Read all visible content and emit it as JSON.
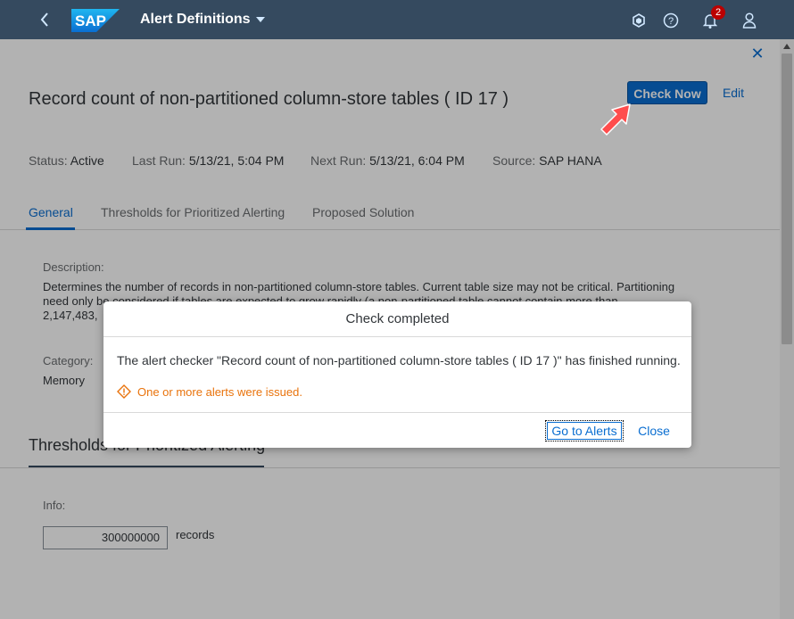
{
  "shell": {
    "logo_text": "SAP",
    "title": "Alert Definitions",
    "notification_count": "2"
  },
  "page": {
    "close_glyph": "✕",
    "object_title": "Record count of non-partitioned column-store tables ( ID 17 )",
    "check_now_label": "Check Now",
    "edit_label": "Edit",
    "attributes": {
      "status_label": "Status:",
      "status_value": "Active",
      "last_run_label": "Last Run:",
      "last_run_value": "5/13/21, 5:04 PM",
      "next_run_label": "Next Run:",
      "next_run_value": "5/13/21, 6:04 PM",
      "source_label": "Source:",
      "source_value": "SAP HANA"
    },
    "tabs": [
      {
        "label": "General"
      },
      {
        "label": "Thresholds for Prioritized Alerting"
      },
      {
        "label": "Proposed Solution"
      }
    ],
    "general": {
      "description_label": "Description:",
      "description_line1": "Determines the number of records in non-partitioned column-store tables. Current table size may not be critical. Partitioning",
      "description_line2": "need only be considered if tables are expected to grow rapidly (a non-partitioned table cannot contain more than",
      "description_line3": "2,147,483,",
      "category_label": "Category:",
      "category_value": "Memory"
    },
    "thresholds": {
      "section_title": "Thresholds for Prioritized Alerting",
      "info_label": "Info:",
      "info_value": "300000000",
      "info_unit": "records"
    }
  },
  "dialog": {
    "title": "Check completed",
    "message": "The alert checker \"Record count of non-partitioned column-store tables ( ID 17 )\" has finished running.",
    "warning": "One or more alerts were issued.",
    "go_to_alerts_label": "Go to Alerts",
    "close_label": "Close"
  },
  "colors": {
    "shell": "#354a5f",
    "accent": "#0a6ed1",
    "warning": "#e9730c",
    "pointer": "#ff4d4d"
  }
}
